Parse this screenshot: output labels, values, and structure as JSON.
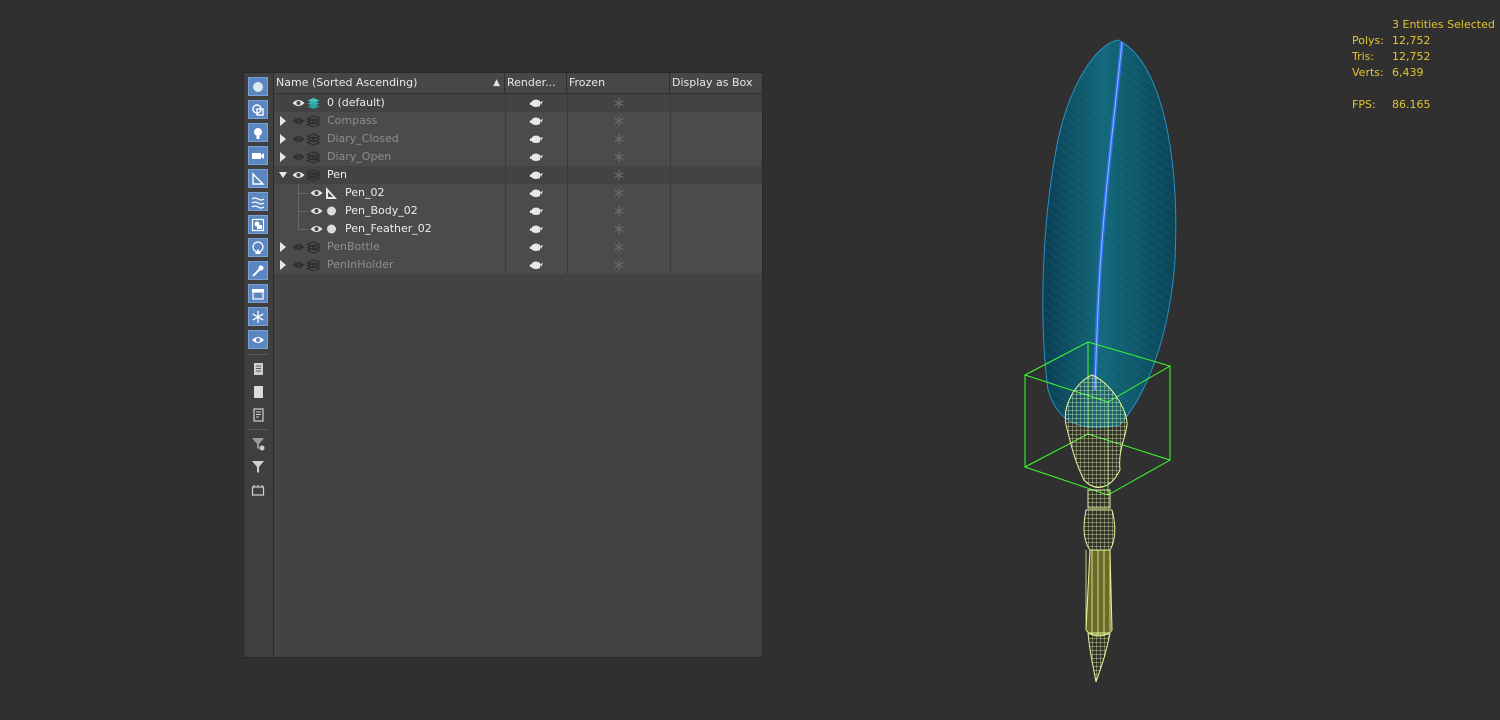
{
  "scene_explorer": {
    "columns": {
      "name": "Name (Sorted Ascending)",
      "render": "Render...",
      "frozen": "Frozen",
      "display_as_box": "Display as Box"
    },
    "rows": [
      {
        "label": "0 (default)",
        "type": "layer-active",
        "state": "bright",
        "expander": "none"
      },
      {
        "label": "Compass",
        "type": "layer",
        "state": "dim",
        "expander": "collapsed"
      },
      {
        "label": "Diary_Closed",
        "type": "layer",
        "state": "dim",
        "expander": "collapsed"
      },
      {
        "label": "Diary_Open",
        "type": "layer",
        "state": "dim",
        "expander": "collapsed"
      },
      {
        "label": "Pen",
        "type": "layer",
        "state": "bright",
        "expander": "expanded"
      },
      {
        "label": "Pen_02",
        "type": "helper",
        "state": "bright",
        "expander": "child"
      },
      {
        "label": "Pen_Body_02",
        "type": "object",
        "state": "bright",
        "expander": "child"
      },
      {
        "label": "Pen_Feather_02",
        "type": "object",
        "state": "bright",
        "expander": "child"
      },
      {
        "label": "PenBottle",
        "type": "layer",
        "state": "dim",
        "expander": "collapsed"
      },
      {
        "label": "PenInHolder",
        "type": "layer",
        "state": "dim",
        "expander": "collapsed"
      }
    ],
    "toolbar_icons": [
      "geometry-filter-icon",
      "shapes-filter-icon",
      "lights-filter-icon",
      "cameras-filter-icon",
      "helpers-filter-icon",
      "space-warps-filter-icon",
      "groups-filter-icon",
      "xrefs-filter-icon",
      "bones-filter-icon",
      "containers-filter-icon",
      "frozen-filter-icon",
      "hidden-filter-icon",
      "select-all-icon",
      "select-none-icon",
      "select-invert-icon",
      "filter-settings-icon",
      "filter-icon",
      "layer-explorer-icon"
    ]
  },
  "viewport_stats": {
    "selection": "3 Entities Selected",
    "polys_label": "Polys:",
    "polys_value": "12,752",
    "tris_label": "Tris:",
    "tris_value": "12,752",
    "verts_label": "Verts:",
    "verts_value": "6,439",
    "fps_label": "FPS:",
    "fps_value": "86.165"
  },
  "colors": {
    "background": "#303030",
    "stats_text": "#e3c430",
    "selection_box": "#3bff2f",
    "feather": "#0f5a68",
    "wire_yellow": "#e6f59a",
    "toolbar_active": "#5b86c1"
  }
}
